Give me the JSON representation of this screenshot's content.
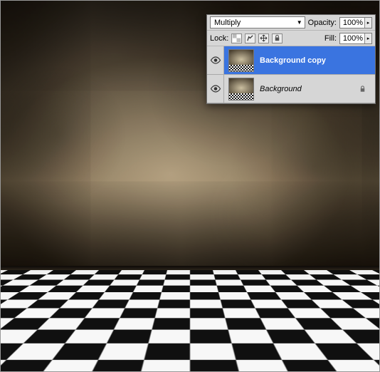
{
  "panel": {
    "blend_mode": "Multiply",
    "opacity_label": "Opacity:",
    "opacity_value": "100%",
    "lock_label": "Lock:",
    "fill_label": "Fill:",
    "fill_value": "100%"
  },
  "layers": [
    {
      "name": "Background copy",
      "visible": true,
      "selected": true,
      "locked": false
    },
    {
      "name": "Background",
      "visible": true,
      "selected": false,
      "locked": true
    }
  ]
}
